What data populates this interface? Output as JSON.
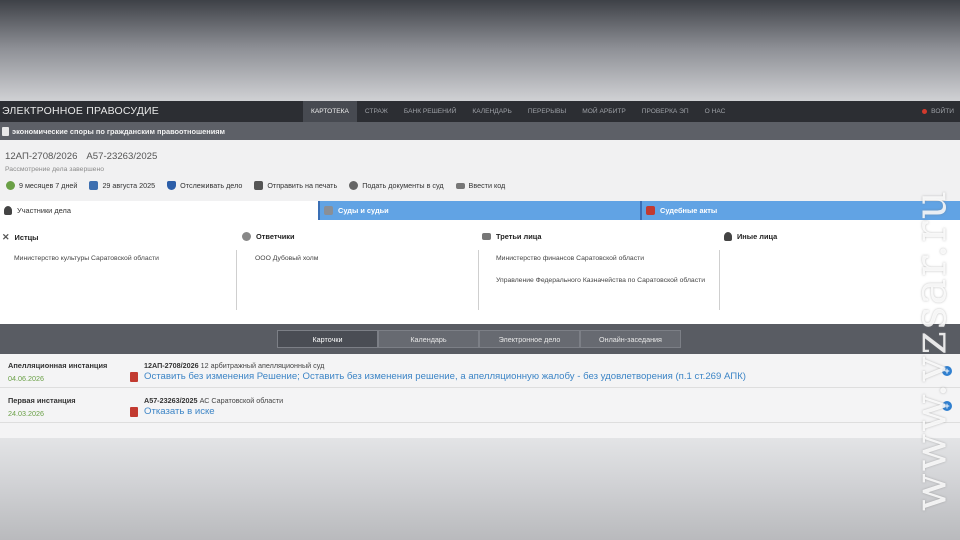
{
  "brand": "ЭЛЕКТРОННОЕ ПРАВОСУДИЕ",
  "menu": [
    "КАРТОТЕКА",
    "СТРАЖ",
    "БАНК РЕШЕНИЙ",
    "КАЛЕНДАРЬ",
    "ПЕРЕРЫВЫ",
    "МОЙ АРБИТР",
    "ПРОВЕРКА ЭП",
    "О НАС"
  ],
  "login": "ВОЙТИ",
  "category": "экономические споры по гражданским правоотношениям",
  "case": {
    "number1": "12АП-2708/2026",
    "number2": "А57-23263/2025",
    "status": "Рассмотрение дела завершено"
  },
  "actions": [
    "9 месяцев 7 дней",
    "29 августа 2025",
    "Отслеживать дело",
    "Отправить на печать",
    "Подать документы в суд",
    "Ввести код"
  ],
  "tabs": [
    "Участники дела",
    "Суды и судьи",
    "Судебные акты"
  ],
  "participants": {
    "plaintiffs": {
      "title": "Истцы",
      "items": [
        "Министерство культуры Саратовской области"
      ]
    },
    "defendants": {
      "title": "Ответчики",
      "items": [
        "ООО Дубовый холм"
      ]
    },
    "third": {
      "title": "Третьи лица",
      "items": [
        "Министерство финансов Саратовской области",
        "Управление Федерального Казначейства по Саратовской области"
      ]
    },
    "other": {
      "title": "Иные лица",
      "items": []
    }
  },
  "subtabs": [
    "Карточки",
    "Календарь",
    "Электронное дело",
    "Онлайн-заседания"
  ],
  "instances": [
    {
      "title": "Апелляционная инстанция",
      "date": "04.06.2026",
      "case_no": "12АП-2708/2026",
      "court": "12 арбитражный апелляционный суд",
      "decision": "Оставить без изменения Решение; Оставить без изменения решение, а апелляционную жалобу - без удовлетворения (п.1 ст.269 АПК)"
    },
    {
      "title": "Первая инстанция",
      "date": "24.03.2026",
      "case_no": "А57-23263/2025",
      "court": "АС Саратовской области",
      "decision": "Отказать в иске"
    }
  ],
  "watermark": "www.vzsar.ru",
  "colors": {
    "nav": "#2c2e33",
    "tab_blue": "#61a3e4",
    "link": "#3d85c6",
    "date_green": "#6aa046"
  }
}
